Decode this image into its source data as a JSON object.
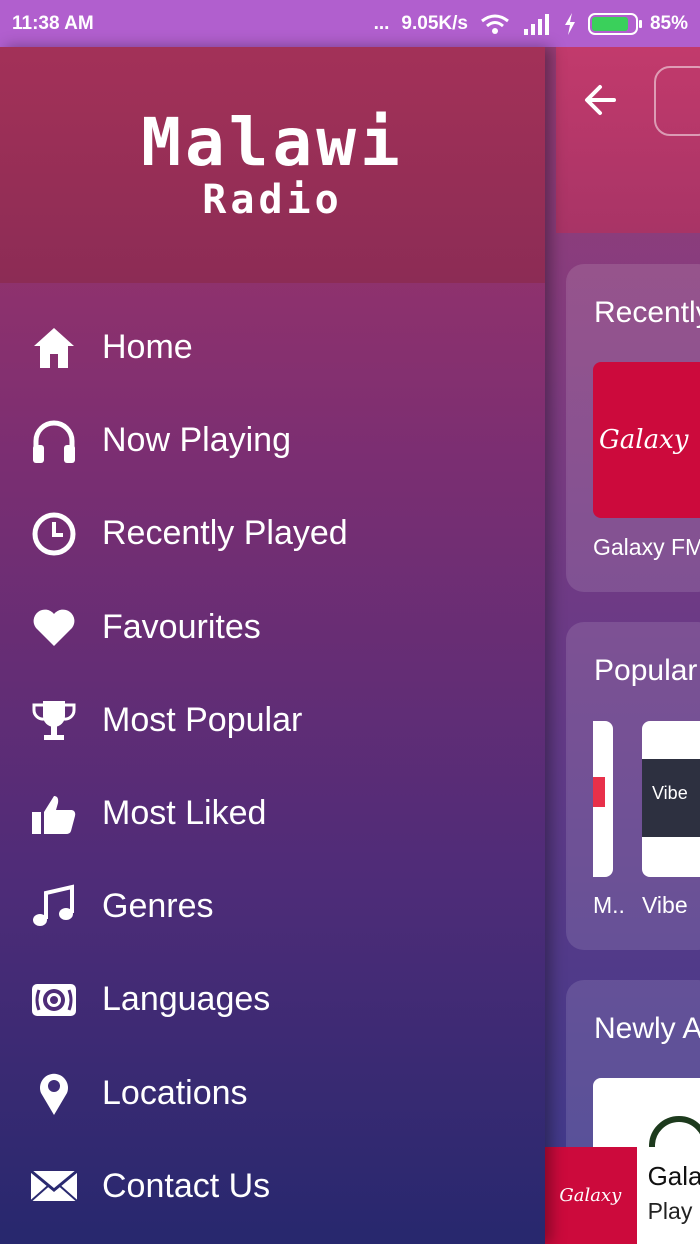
{
  "status_bar": {
    "time": "11:38 AM",
    "dots": "...",
    "speed": "9.05K/s",
    "battery": "85%",
    "battery_level": 0.85,
    "battery_color": "#3ad05b"
  },
  "drawer": {
    "logo_title": "Malawi",
    "logo_subtitle": "Radio",
    "menu": [
      {
        "label": "Home",
        "icon": "home-icon"
      },
      {
        "label": "Now Playing",
        "icon": "headphones-icon"
      },
      {
        "label": "Recently Played",
        "icon": "clock-icon"
      },
      {
        "label": "Favourites",
        "icon": "heart-icon"
      },
      {
        "label": "Most Popular",
        "icon": "trophy-icon"
      },
      {
        "label": "Most Liked",
        "icon": "thumbs-up-icon"
      },
      {
        "label": "Genres",
        "icon": "music-note-icon"
      },
      {
        "label": "Languages",
        "icon": "broadcast-icon"
      },
      {
        "label": "Locations",
        "icon": "map-pin-icon"
      },
      {
        "label": "Contact Us",
        "icon": "mail-icon"
      }
    ]
  },
  "main": {
    "sections": [
      {
        "title": "Recently",
        "items": [
          {
            "logo_text": "Galaxy",
            "label": "Galaxy FM"
          }
        ]
      },
      {
        "title": "Popular",
        "items": [
          {
            "label": "M.."
          },
          {
            "logo_text": "Vibe",
            "label": "Vibe"
          }
        ]
      },
      {
        "title": "Newly A"
      }
    ]
  },
  "mini_player": {
    "art_text": "Galaxy",
    "title": "Gala",
    "subtitle": "Play"
  },
  "colors": {
    "status_bar": "#b15fce",
    "accent_red": "#cc0a3c"
  }
}
